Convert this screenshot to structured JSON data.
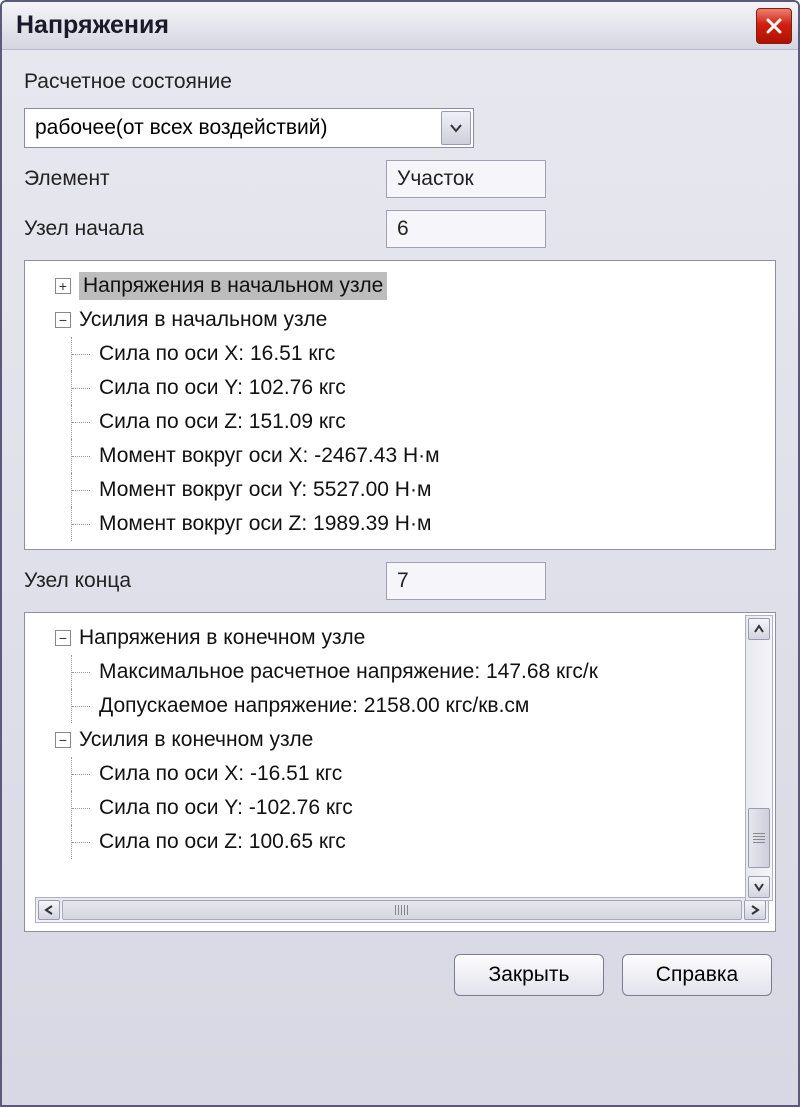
{
  "title": "Напряжения",
  "labels": {
    "calc_state": "Расчетное состояние",
    "element": "Элемент",
    "start_node": "Узел начала",
    "end_node": "Узел конца"
  },
  "calc_state_value": "рабочее(от всех воздействий)",
  "element_value": "Участок",
  "start_node_value": "6",
  "end_node_value": "7",
  "tree1": {
    "node0": "Напряжения в начальном узле",
    "node1": "Усилия в начальном узле",
    "c0": "Сила по оси X: 16.51 кгс",
    "c1": "Сила по оси Y: 102.76 кгс",
    "c2": "Сила по оси Z: 151.09 кгс",
    "c3": "Момент вокруг оси X: -2467.43 Н·м",
    "c4": "Момент вокруг оси Y: 5527.00 Н·м",
    "c5": "Момент вокруг оси Z: 1989.39 Н·м"
  },
  "tree2": {
    "node0": "Напряжения в конечном узле",
    "c0": "Максимальное расчетное напряжение: 147.68 кгс/к",
    "c1": "Допускаемое напряжение: 2158.00 кгс/кв.см",
    "node1": "Усилия в конечном узле",
    "c2": "Сила по оси X: -16.51 кгс",
    "c3": "Сила по оси Y: -102.76 кгс",
    "c4": "Сила по оси Z: 100.65 кгс"
  },
  "buttons": {
    "close": "Закрыть",
    "help": "Справка"
  }
}
